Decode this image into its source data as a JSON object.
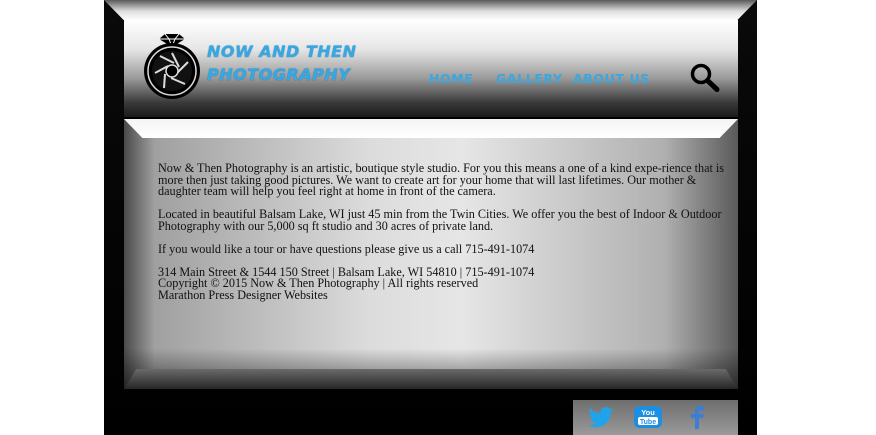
{
  "brand": {
    "line1": "NOW AND THEN",
    "line2": "PHOTOGRAPHY"
  },
  "nav": {
    "items": [
      {
        "label": "HOME"
      },
      {
        "label": "GALLERY"
      },
      {
        "label": "ABOUT US"
      }
    ]
  },
  "content": {
    "paragraph1": "Now & Then Photography is an artistic, boutique style studio. For you this means a one of a kind expe-rience that is more then just taking good pictures. We want to create art for your home that will last lifetimes. Our mother & daughter team will help you feel right at home in front of the camera.",
    "paragraph2": "Located in beautiful Balsam Lake, WI just 45 min from the Twin Cities.  We offer you the best of Indoor & Outdoor Photography with our 5,000 sq ft studio and 30 acres of private land.",
    "paragraph3": "If you would like a tour or have questions please give us a call 715-491-1074",
    "address": "314 Main Street & 1544 150 Street | Balsam Lake, WI 54810 | 715-491-1074",
    "copyright": "Copyright © 2015 Now & Then Photography | All rights reserved",
    "credit": "Marathon Press Designer Websites"
  },
  "social": {
    "icons": [
      "twitter-icon",
      "youtube-icon",
      "facebook-icon"
    ],
    "youtube_label": "You Tube",
    "colors": {
      "twitter": "#1fa3ea",
      "youtube": "#1e8fe0",
      "facebook": "#3b7ed6"
    }
  },
  "colors": {
    "accent": "#35a8e6",
    "frame": "#000000"
  }
}
